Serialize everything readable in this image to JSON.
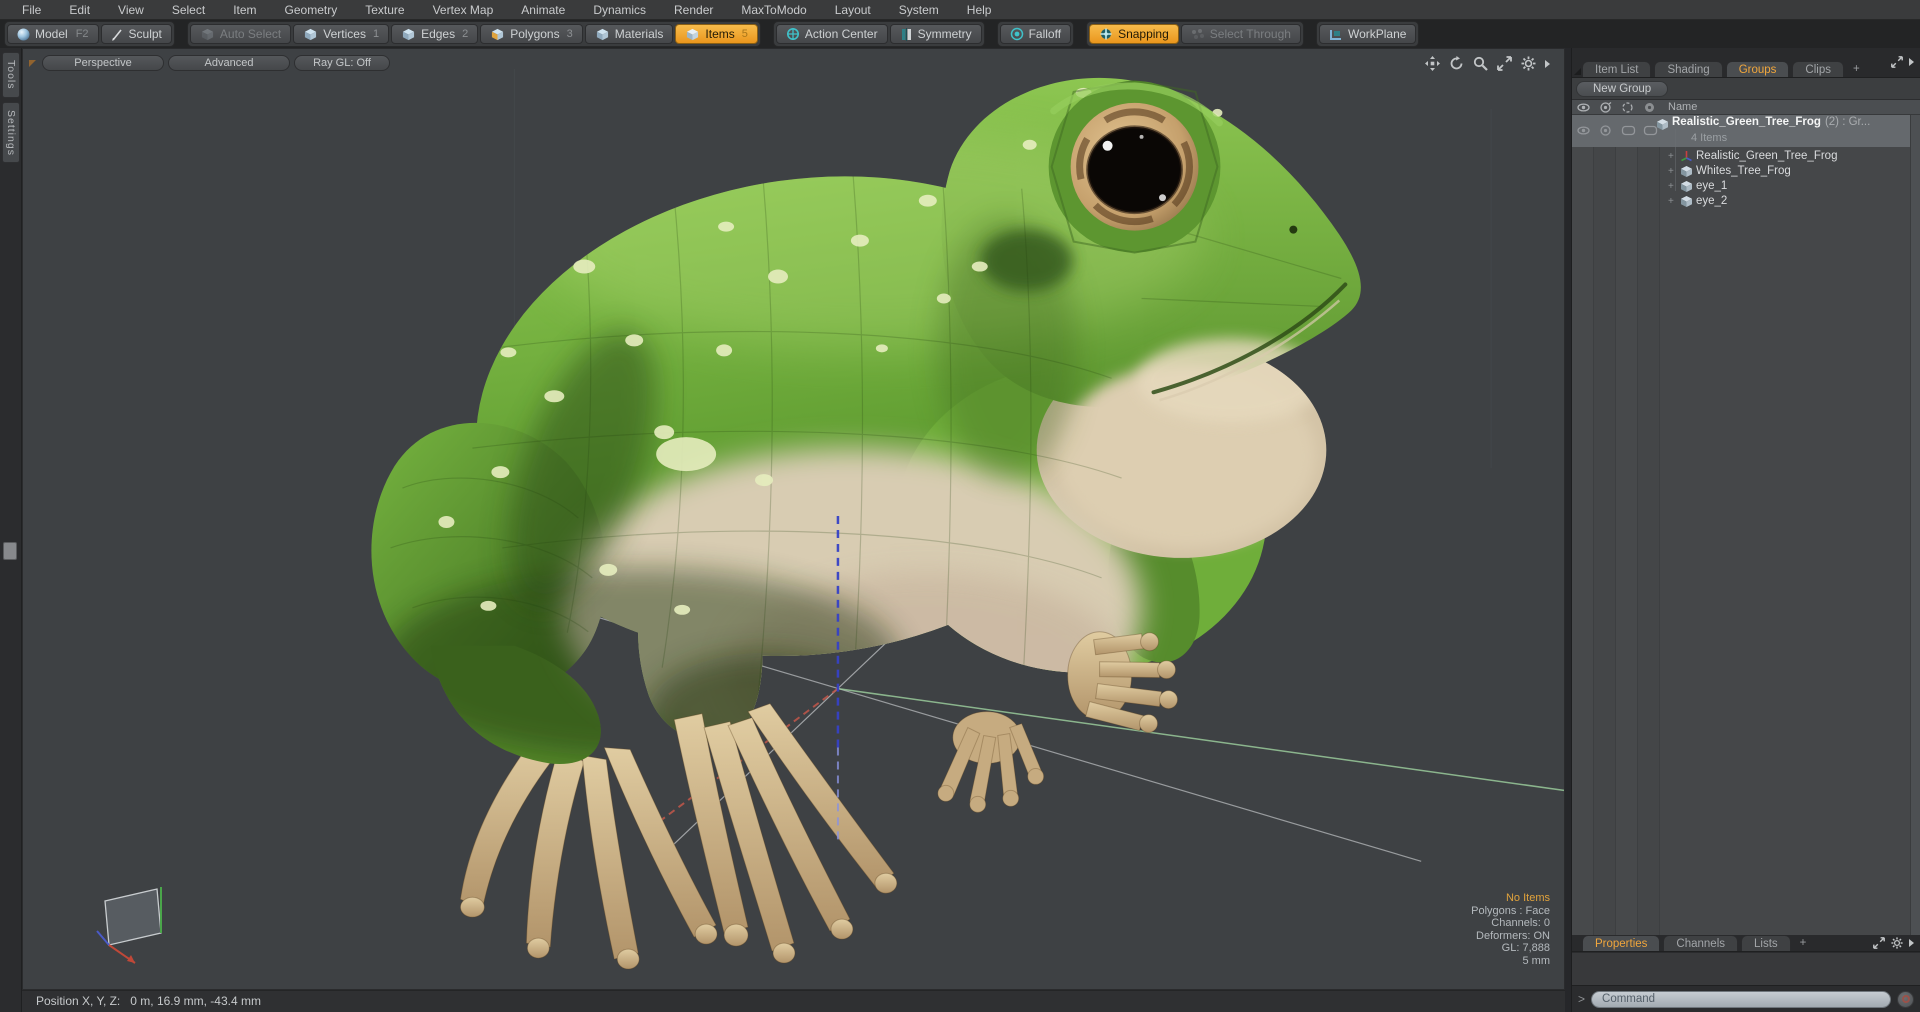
{
  "menu_bar": {
    "items": [
      "File",
      "Edit",
      "View",
      "Select",
      "Item",
      "Geometry",
      "Texture",
      "Vertex Map",
      "Animate",
      "Dynamics",
      "Render",
      "MaxToModo",
      "Layout",
      "System",
      "Help"
    ]
  },
  "toolbar": {
    "model_label": "Model",
    "model_shortcut": "F2",
    "sculpt_label": "Sculpt",
    "auto_select_label": "Auto Select",
    "vertices_label": "Vertices",
    "vertices_num": "1",
    "edges_label": "Edges",
    "edges_num": "2",
    "polygons_label": "Polygons",
    "polygons_num": "3",
    "materials_label": "Materials",
    "items_label": "Items",
    "items_num": "5",
    "action_center_label": "Action Center",
    "symmetry_label": "Symmetry",
    "falloff_label": "Falloff",
    "snapping_label": "Snapping",
    "select_through_label": "Select Through",
    "workplane_label": "WorkPlane"
  },
  "left_dock": {
    "tabs": [
      "Tools",
      "Settings"
    ]
  },
  "viewport": {
    "mode_buttons": [
      "Perspective",
      "Advanced",
      "Ray GL: Off"
    ],
    "status_lines": [
      "No Items",
      "Polygons : Face",
      "Channels: 0",
      "Deformers: ON",
      "GL: 7,888",
      "5 mm"
    ]
  },
  "groups_panel": {
    "tabs": [
      "Item List",
      "Shading",
      "Groups",
      "Clips",
      "+"
    ],
    "active_tab": "Groups",
    "new_group_button": "New Group",
    "columns_header": "Name",
    "root_item": {
      "name": "Realistic_Green_Tree_Frog",
      "meta": "(2) : Gr...",
      "count_label": "4 Items"
    },
    "children": [
      {
        "name": "Realistic_Green_Tree_Frog",
        "icon": "locator-icon"
      },
      {
        "name": "Whites_Tree_Frog",
        "icon": "mesh-icon"
      },
      {
        "name": "eye_1",
        "icon": "mesh-icon"
      },
      {
        "name": "eye_2",
        "icon": "mesh-icon"
      }
    ]
  },
  "properties_panel": {
    "tabs": [
      "Properties",
      "Channels",
      "Lists",
      "+"
    ],
    "active_tab": "Properties"
  },
  "command_bar": {
    "prompt": ">",
    "placeholder": "Command"
  },
  "status_bar": {
    "label": "Position X, Y, Z:",
    "value": "0 m, 16.9 mm, -43.4 mm"
  },
  "colors": {
    "accent_orange": "#f0a63c",
    "selection_gray": "#65696d",
    "viewport_bg": "#3e4144",
    "frog_green": "#66a334",
    "eye_iris_tan": "#c8a571",
    "axis_blue": "#3642c6",
    "axis_red": "#c2574a",
    "axis_green": "#9fd3a0"
  }
}
